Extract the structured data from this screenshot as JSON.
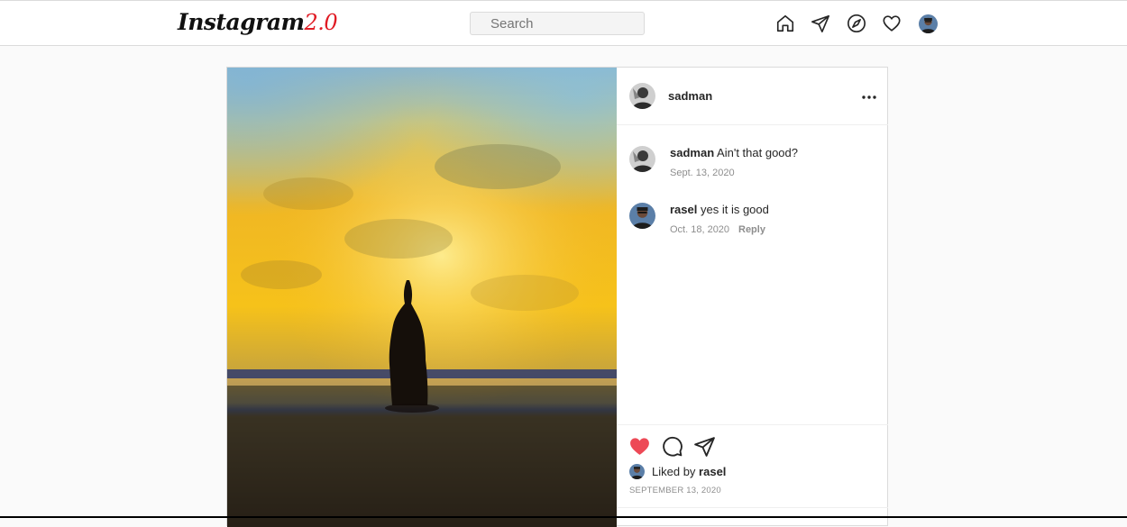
{
  "header": {
    "brand_main": "Instagram",
    "brand_version": "2.0",
    "brand_version_color": "#e01b24",
    "search_placeholder": "Search",
    "icons": [
      "home-icon",
      "send-icon",
      "explore-icon",
      "heart-icon"
    ]
  },
  "post": {
    "author": "sadman",
    "more_icon": "more-dots-icon",
    "comments": [
      {
        "user": "sadman",
        "text": "Ain't that good?",
        "date": "Sept. 13, 2020",
        "reply": ""
      },
      {
        "user": "rasel",
        "text": "yes it is good",
        "date": "Oct. 18, 2020",
        "reply": "Reply"
      }
    ],
    "actions": {
      "like_icon": "heart-filled-icon",
      "like_color": "#ed4956",
      "comment_icon": "comment-icon",
      "share_icon": "share-icon"
    },
    "liked_prefix": "Liked by",
    "liked_user": "rasel",
    "date": "SEPTEMBER 13, 2020"
  }
}
